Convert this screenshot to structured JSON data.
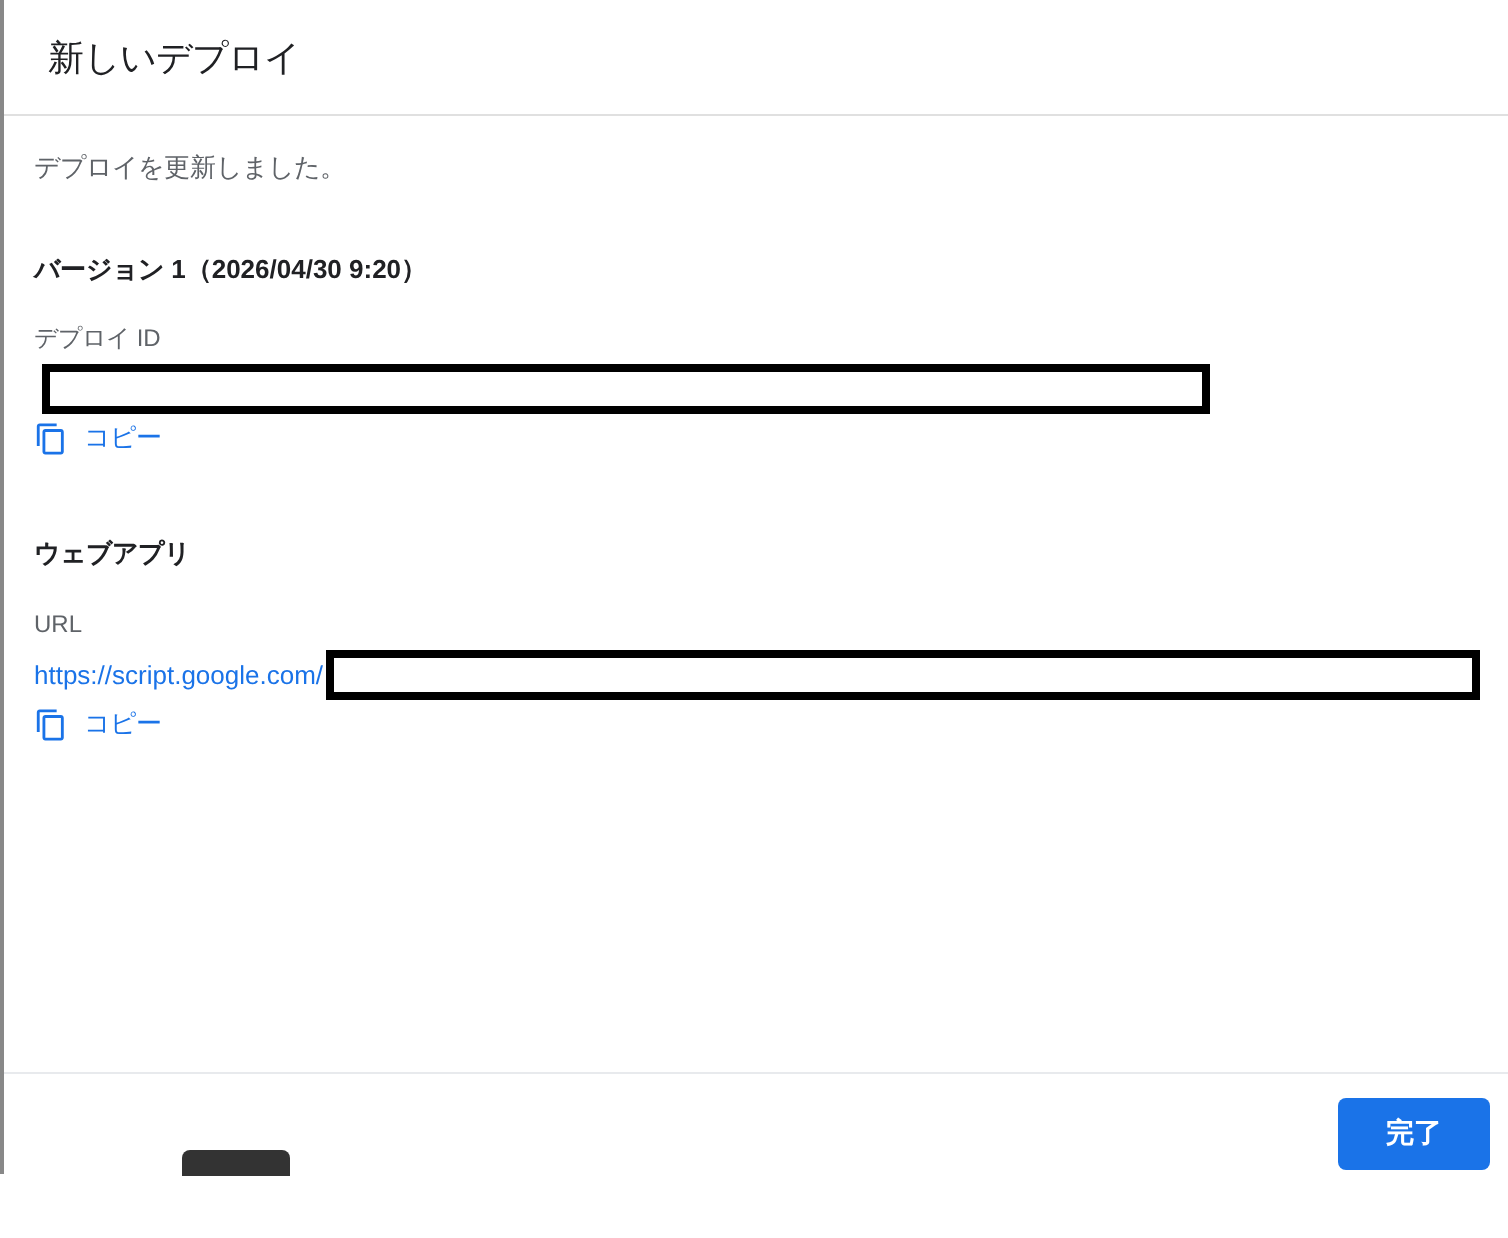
{
  "dialog": {
    "title": "新しいデプロイ"
  },
  "message": "デプロイを更新しました。",
  "version_heading": "バージョン 1（2026/04/30 9:20）",
  "sections": [
    {
      "kind": "id",
      "label": "デプロイ ID",
      "copy": "コピー"
    },
    {
      "kind": "url",
      "heading": "ウェブアプリ",
      "label": "URL",
      "value_prefix": "https://script.google.com/",
      "copy": "コピー"
    }
  ],
  "footer": {
    "button": "完了"
  }
}
